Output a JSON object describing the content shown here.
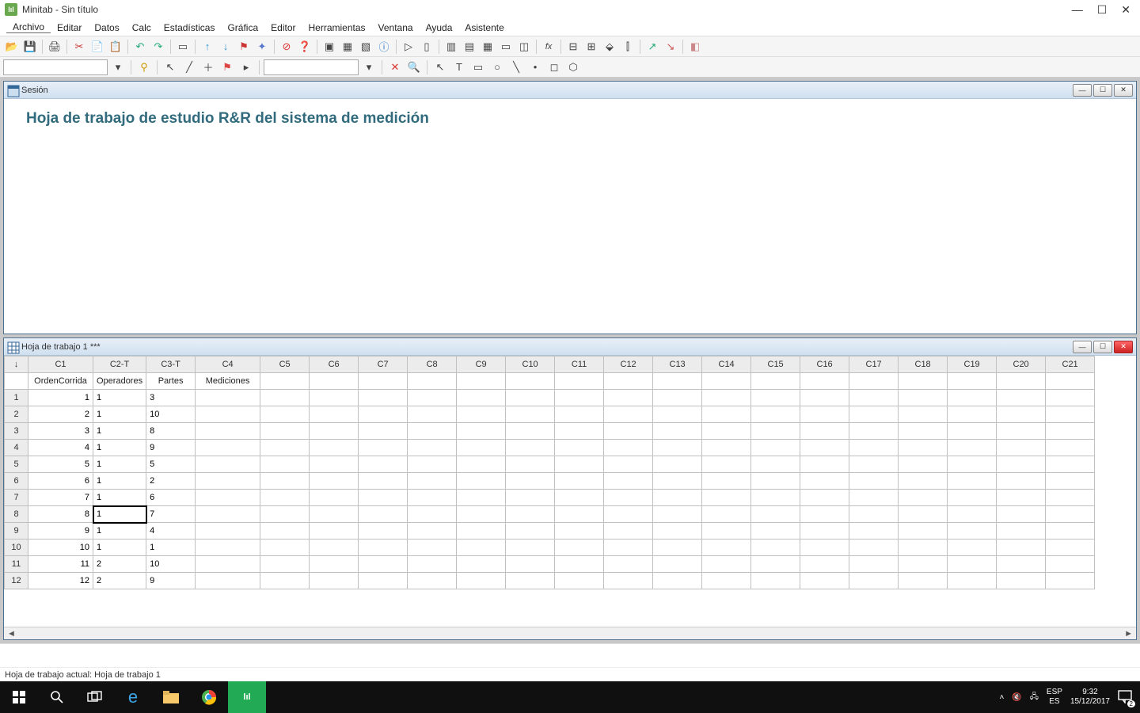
{
  "titlebar": {
    "app_name": "Minitab",
    "doc_name": "Sin título"
  },
  "menus": [
    "Archivo",
    "Editar",
    "Datos",
    "Calc",
    "Estadísticas",
    "Gráfica",
    "Editor",
    "Herramientas",
    "Ventana",
    "Ayuda",
    "Asistente"
  ],
  "session": {
    "title": "Sesión",
    "heading": "Hoja de trabajo de estudio R&R del sistema de medición"
  },
  "worksheet": {
    "title": "Hoja de trabajo 1 ***",
    "col_ids": [
      "C1",
      "C2-T",
      "C3-T",
      "C4",
      "C5",
      "C6",
      "C7",
      "C8",
      "C9",
      "C10",
      "C11",
      "C12",
      "C13",
      "C14",
      "C15",
      "C16",
      "C17",
      "C18",
      "C19",
      "C20",
      "C21"
    ],
    "col_names": [
      "OrdenCorrida",
      "Operadores",
      "Partes",
      "Mediciones",
      "",
      "",
      "",
      "",
      "",
      "",
      "",
      "",
      "",
      "",
      "",
      "",
      "",
      "",
      "",
      "",
      ""
    ],
    "rows": [
      {
        "n": "1",
        "c1": "1",
        "c2": "1",
        "c3": "3",
        "c4": ""
      },
      {
        "n": "2",
        "c1": "2",
        "c2": "1",
        "c3": "10",
        "c4": ""
      },
      {
        "n": "3",
        "c1": "3",
        "c2": "1",
        "c3": "8",
        "c4": ""
      },
      {
        "n": "4",
        "c1": "4",
        "c2": "1",
        "c3": "9",
        "c4": ""
      },
      {
        "n": "5",
        "c1": "5",
        "c2": "1",
        "c3": "5",
        "c4": ""
      },
      {
        "n": "6",
        "c1": "6",
        "c2": "1",
        "c3": "2",
        "c4": ""
      },
      {
        "n": "7",
        "c1": "7",
        "c2": "1",
        "c3": "6",
        "c4": ""
      },
      {
        "n": "8",
        "c1": "8",
        "c2": "1",
        "c3": "7",
        "c4": ""
      },
      {
        "n": "9",
        "c1": "9",
        "c2": "1",
        "c3": "4",
        "c4": ""
      },
      {
        "n": "10",
        "c1": "10",
        "c2": "1",
        "c3": "1",
        "c4": ""
      },
      {
        "n": "11",
        "c1": "11",
        "c2": "2",
        "c3": "10",
        "c4": ""
      },
      {
        "n": "12",
        "c1": "12",
        "c2": "2",
        "c3": "9",
        "c4": ""
      }
    ],
    "active_cell": {
      "row": 8,
      "col": 2
    }
  },
  "statusbar": {
    "text": "Hoja de trabajo actual: Hoja de trabajo 1"
  },
  "taskbar": {
    "lang1": "ESP",
    "lang2": "ES",
    "time": "9:32",
    "date": "15/12/2017",
    "notif_count": "2"
  }
}
